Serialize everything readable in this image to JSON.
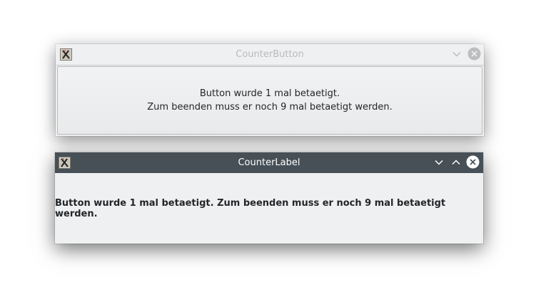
{
  "windows": {
    "counter_button": {
      "title": "CounterButton",
      "line1": "Button wurde 1 mal betaetigt.",
      "line2": "Zum beenden muss er noch 9 mal betaetigt werden.",
      "icons": [
        "x-app-icon",
        "minimize-chevron-icon",
        "close-icon"
      ],
      "titlebar_color": "#eff0f1",
      "title_color": "#b9babc"
    },
    "counter_label": {
      "title": "CounterLabel",
      "text": "Button wurde 1 mal betaetigt. Zum beenden muss er noch 9 mal betaetigt werden.",
      "icons": [
        "x-app-icon",
        "minimize-chevron-icon",
        "maximize-chevron-icon",
        "close-icon"
      ],
      "titlebar_color": "#475057",
      "title_color": "#ffffff"
    }
  }
}
